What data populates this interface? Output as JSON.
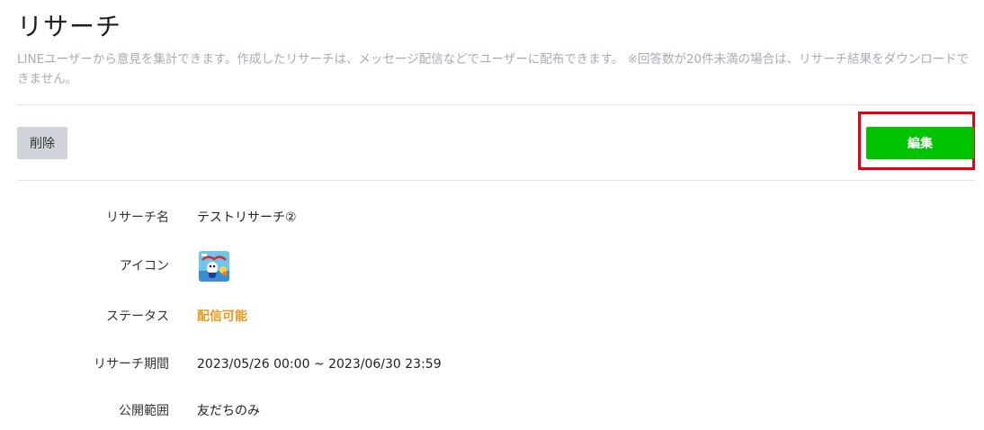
{
  "header": {
    "title": "リサーチ",
    "description": "LINEユーザーから意見を集計できます。作成したリサーチは、メッセージ配信などでユーザーに配布できます。 ※回答数が20件未満の場合は、リサーチ結果をダウンロードできません。"
  },
  "toolbar": {
    "delete_label": "削除",
    "edit_label": "編集"
  },
  "details": {
    "name_label": "リサーチ名",
    "name_value": "テストリサーチ②",
    "icon_label": "アイコン",
    "icon_name": "research-thumbnail-icon",
    "status_label": "ステータス",
    "status_value": "配信可能",
    "period_label": "リサーチ期間",
    "period_value": "2023/05/26 00:00 ~ 2023/06/30 23:59",
    "visibility_label": "公開範囲",
    "visibility_value": "友だちのみ"
  },
  "colors": {
    "accent_green": "#00c300",
    "status_orange": "#f0961e",
    "highlight_red": "#e60012",
    "muted_text": "#a7adb5"
  }
}
